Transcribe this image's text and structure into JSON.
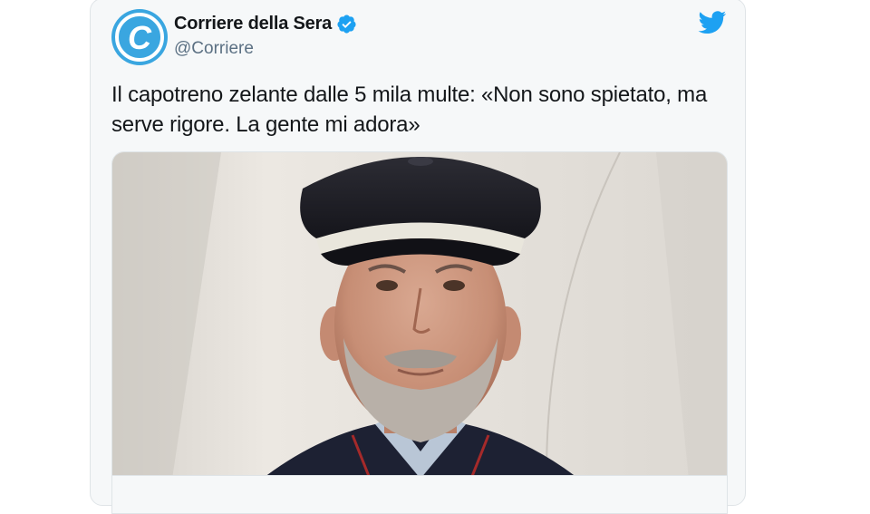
{
  "tweet": {
    "display_name": "Corriere della Sera",
    "handle": "@Corriere",
    "verified": true,
    "avatar_letter": "C",
    "text": "Il capotreno zelante dalle 5 mila multe: «Non sono spietato, ma serve rigore. La gente mi adora»",
    "media": {
      "kind": "photo",
      "subject": "conductor-in-uniform-cap"
    }
  },
  "colors": {
    "brand_blue": "#1da1f2",
    "avatar_blue": "#3aa6e0",
    "verified_blue": "#1da1f2",
    "card_background": "#f6f8f9",
    "handle_gray": "#5b7083"
  },
  "icons": [
    "corriere-logo-icon",
    "verified-badge-icon",
    "twitter-bird-icon"
  ]
}
